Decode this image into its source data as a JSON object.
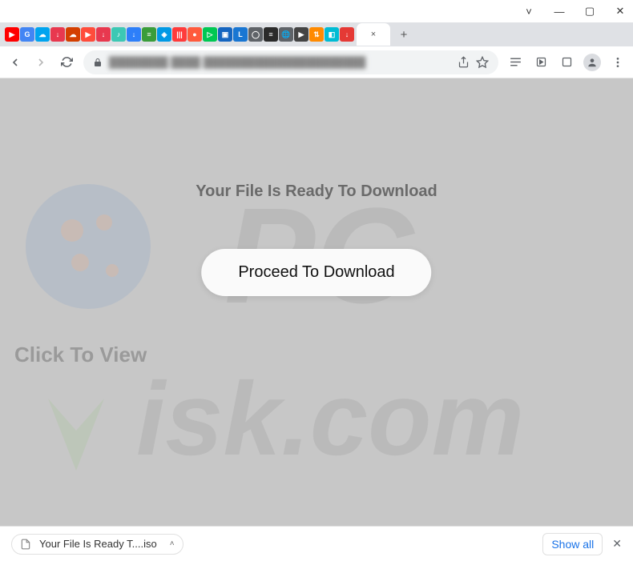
{
  "window": {
    "controls": {
      "min": "—",
      "max": "▢",
      "close": "✕",
      "dropdown": "˅"
    }
  },
  "tabs": {
    "close": "×",
    "new": "+",
    "favicons": [
      {
        "bg": "#ff0000",
        "t": "▶"
      },
      {
        "bg": "#4285f4",
        "t": "G"
      },
      {
        "bg": "#00a4ef",
        "t": "☁"
      },
      {
        "bg": "#e8384f",
        "t": "↓"
      },
      {
        "bg": "#d43f00",
        "t": "☁"
      },
      {
        "bg": "#ff4c3b",
        "t": "▶"
      },
      {
        "bg": "#e8384f",
        "t": "↓"
      },
      {
        "bg": "#3cc8b4",
        "t": "♪"
      },
      {
        "bg": "#2d7ff9",
        "t": "↓"
      },
      {
        "bg": "#3a9d3a",
        "t": "≡"
      },
      {
        "bg": "#0099e5",
        "t": "◈"
      },
      {
        "bg": "#ff3b3b",
        "t": "|||"
      },
      {
        "bg": "#ff5a3c",
        "t": "●"
      },
      {
        "bg": "#00c853",
        "t": "▷"
      },
      {
        "bg": "#1565c0",
        "t": "▣"
      },
      {
        "bg": "#1976d2",
        "t": "L"
      },
      {
        "bg": "#5f6368",
        "t": "◯"
      },
      {
        "bg": "#2b2b2b",
        "t": "≡"
      },
      {
        "bg": "#5f6368",
        "t": "🌐"
      },
      {
        "bg": "#444",
        "t": "▶"
      },
      {
        "bg": "#ff8a00",
        "t": "⇅"
      },
      {
        "bg": "#00bcd4",
        "t": "◧"
      },
      {
        "bg": "#e53935",
        "t": "↓"
      }
    ]
  },
  "toolbar": {
    "url_display": "████████  ████  ██████████████████████"
  },
  "page": {
    "heading": "Your File Is Ready To Download",
    "button": "Proceed To Download",
    "side": "Click To View"
  },
  "downloads": {
    "file": "Your File Is Ready T....iso",
    "showall": "Show all",
    "chevron": "˄",
    "close": "✕"
  },
  "watermark": {
    "top": "PC",
    "bottom": "isk.com"
  }
}
